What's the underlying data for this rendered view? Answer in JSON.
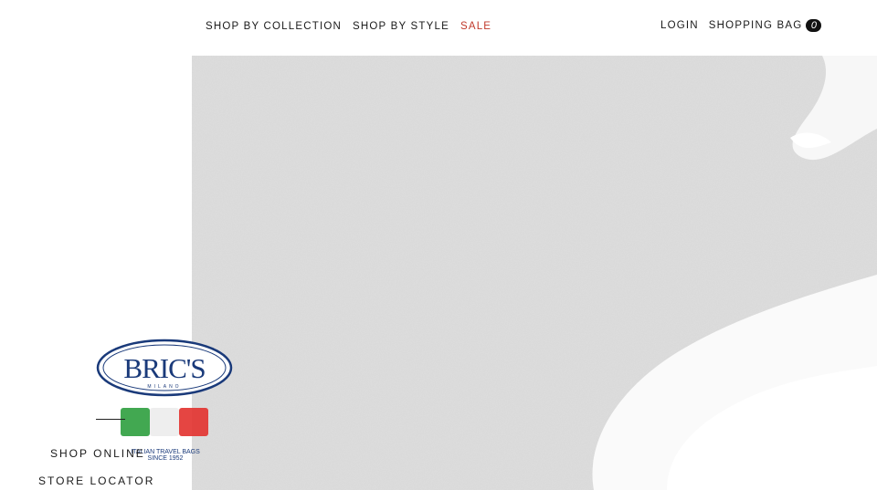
{
  "nav": {
    "collection": "SHOP BY COLLECTION",
    "style": "SHOP BY STYLE",
    "sale": "SALE"
  },
  "account": {
    "login": "LOGIN",
    "bag": "SHOPPING BAG",
    "bag_count": "0"
  },
  "logo": {
    "brand": "BRIC'S",
    "city": "MILANO",
    "tagline_1": "ITALIAN TRAVEL BAGS",
    "tagline_2": "SINCE 1952"
  },
  "sidebar": {
    "shop_online": "SHOP ONLINE",
    "store_locator": "STORE LOCATOR"
  },
  "colors": {
    "sale": "#c0392b",
    "brand_blue": "#1a3a7a",
    "flag_green": "#2e9e3e",
    "flag_red": "#e2312d"
  }
}
